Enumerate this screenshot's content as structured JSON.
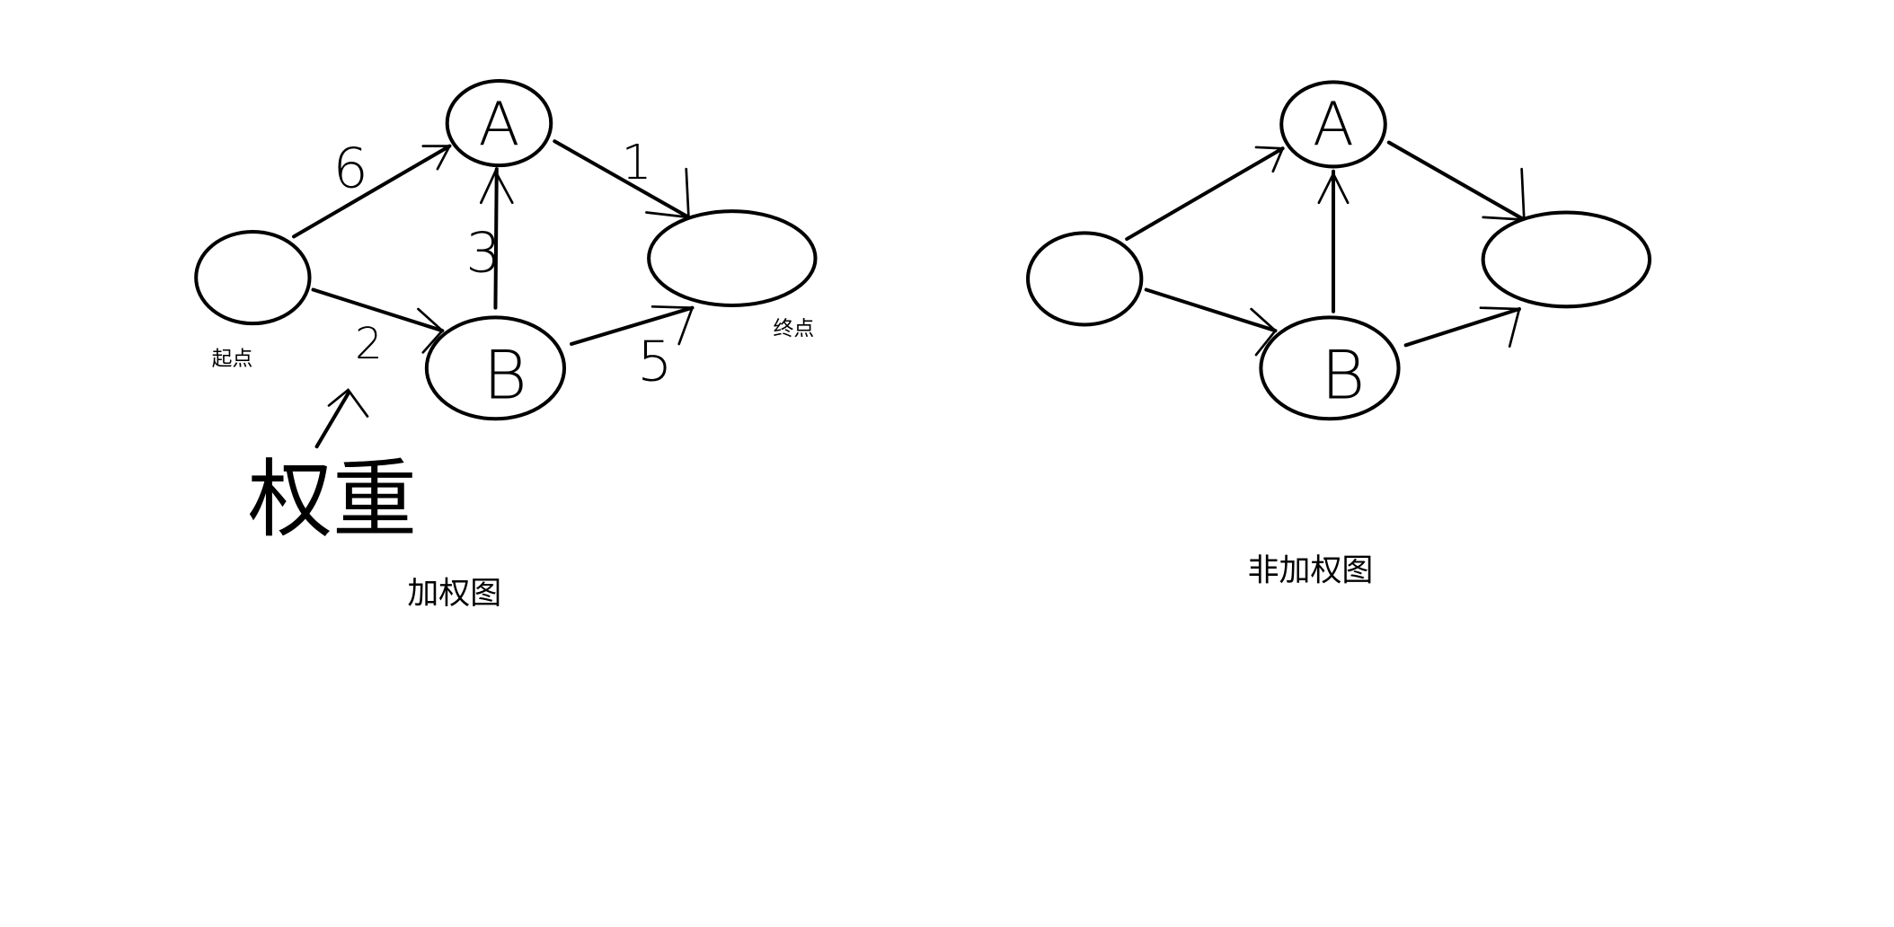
{
  "weighted_graph": {
    "caption": "加权图",
    "start_label": "起点",
    "end_label": "终点",
    "node_a": "A",
    "node_b": "B",
    "weights": {
      "start_to_a": "6",
      "b_to_a": "3",
      "a_to_end": "1",
      "start_to_b": "2",
      "b_to_end": "5"
    },
    "weight_annotation": "权重"
  },
  "unweighted_graph": {
    "caption": "非加权图",
    "node_a": "A",
    "node_b": "B"
  }
}
